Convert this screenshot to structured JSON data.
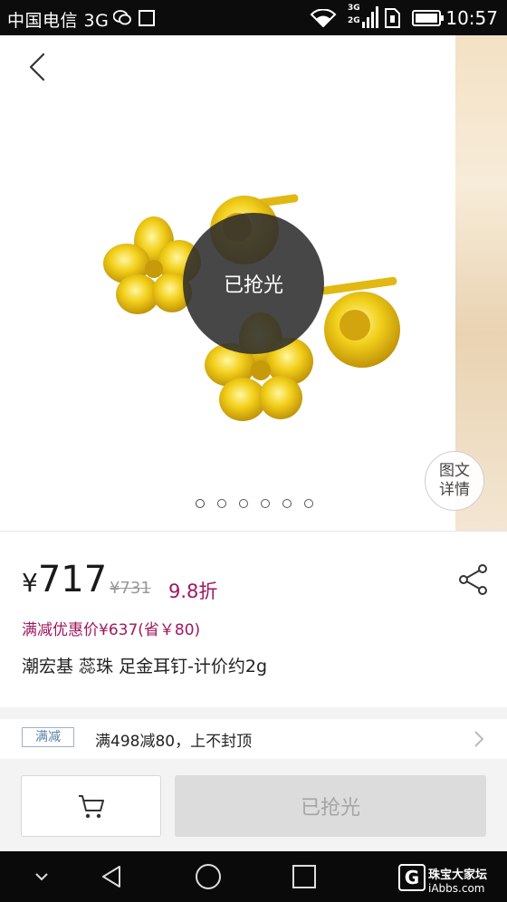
{
  "status_bar": {
    "carrier": "中国电信 3G",
    "network_labels": [
      "3G",
      "2G"
    ],
    "time": "10:57"
  },
  "product_image": {
    "badge": "已抢光",
    "detail_button_line1": "图文",
    "detail_button_line2": "详情",
    "page_indicator_count": 6,
    "active_page": 1
  },
  "price": {
    "currency": "¥",
    "current": "717",
    "original": "¥731",
    "discount": "9.8折"
  },
  "promo_price": "满减优惠价¥637(省￥80)",
  "product_title": "潮宏基 蕊珠 足金耳钉-计价约2g",
  "promotion": {
    "tag": "满减",
    "text": "满498减80，上不封顶"
  },
  "actions": {
    "cart_icon": "cart-icon",
    "soldout_label": "已抢光"
  },
  "watermark": {
    "logo": "G",
    "name": "珠宝大家坛",
    "url": "iAbbs.com"
  },
  "colors": {
    "accent": "#a0185e",
    "tag_border": "#9bb1c9",
    "disabled_button": "#dcdcdc"
  }
}
